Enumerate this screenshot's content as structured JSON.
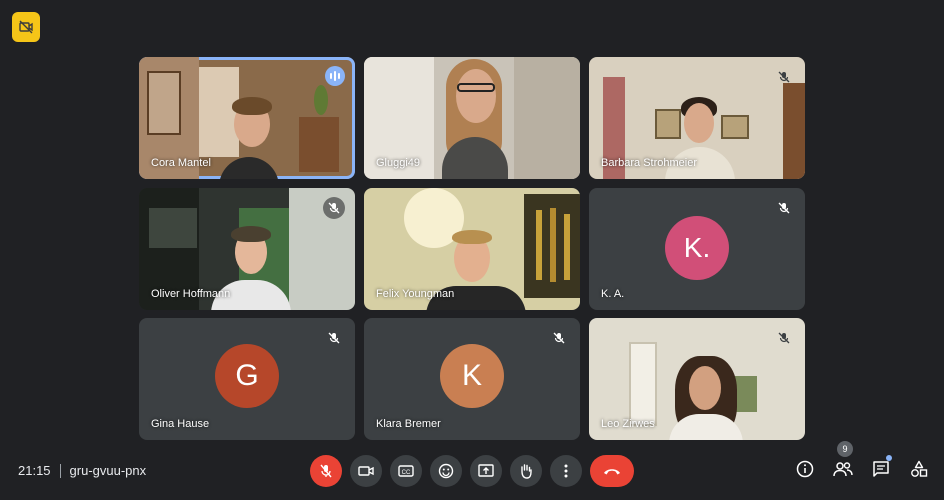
{
  "meeting": {
    "time": "21:15",
    "code": "gru-gvuu-pnx"
  },
  "participants_count": "9",
  "tiles": [
    {
      "name": "Cora Mantel",
      "type": "video",
      "speaking": true,
      "muted": false
    },
    {
      "name": "Gluggi49",
      "type": "video",
      "speaking": false,
      "muted": false
    },
    {
      "name": "Barbara Strohmeier",
      "type": "video",
      "speaking": false,
      "muted": true
    },
    {
      "name": "Oliver Hoffmann",
      "type": "video",
      "speaking": false,
      "muted": true
    },
    {
      "name": "Felix Youngman",
      "type": "video",
      "speaking": false,
      "muted": false
    },
    {
      "name": "K. A.",
      "type": "avatar",
      "initial": "K.",
      "color": "#d14f78",
      "muted": true
    },
    {
      "name": "Gina Hause",
      "type": "avatar",
      "initial": "G",
      "color": "#b6472a",
      "muted": true
    },
    {
      "name": "Klara Bremer",
      "type": "avatar",
      "initial": "K",
      "color": "#c97f52",
      "muted": true
    },
    {
      "name": "Leo Zirwes",
      "type": "video",
      "speaking": false,
      "muted": true
    }
  ],
  "colors": {
    "background": "#202124",
    "tile": "#3c4043",
    "accent": "#8ab4f8",
    "danger": "#ea4335"
  },
  "icons": {
    "top_left": "no-camera-icon",
    "controls": [
      "mic-off-icon",
      "camera-icon",
      "captions-icon",
      "emoji-icon",
      "present-icon",
      "raise-hand-icon",
      "more-options-icon",
      "end-call-icon"
    ],
    "right": [
      "info-icon",
      "people-icon",
      "chat-icon",
      "activities-icon"
    ]
  }
}
